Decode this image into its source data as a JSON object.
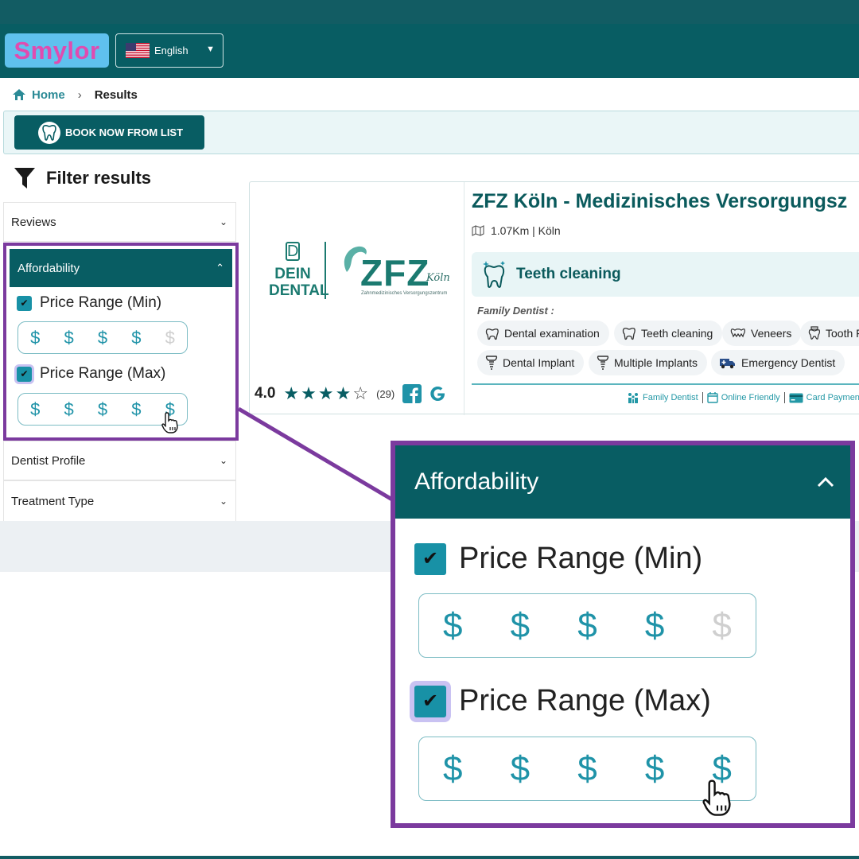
{
  "header": {
    "logo_text": "Smylor",
    "language": "English"
  },
  "breadcrumb": {
    "home": "Home",
    "current": "Results"
  },
  "book_button": "BOOK NOW FROM LIST",
  "filter": {
    "title": "Filter results",
    "sections": {
      "reviews": "Reviews",
      "affordability": "Affordability",
      "dentist_profile": "Dentist Profile",
      "treatment_type": "Treatment Type"
    },
    "price_min": {
      "label": "Price Range (Min)",
      "checked": true,
      "symbols": [
        "$",
        "$",
        "$",
        "$",
        "$"
      ],
      "active_count": 4
    },
    "price_max": {
      "label": "Price Range (Max)",
      "checked": true,
      "symbols": [
        "$",
        "$",
        "$",
        "$",
        "$"
      ],
      "active_count": 5
    }
  },
  "result": {
    "title": "ZFZ Köln - Medizinisches Versorgungsz",
    "distance": "1.07Km | Köln",
    "treatment": "Teeth cleaning",
    "category_label": "Family Dentist :",
    "tags": [
      "Dental examination",
      "Teeth cleaning",
      "Veneers",
      "Tooth F",
      "Dental Implant",
      "Multiple Implants",
      "Emergency Dentist"
    ],
    "rating": "4.0",
    "stars": 4,
    "reviews_count": "(29)",
    "logo": {
      "dein_top": "DEIN",
      "dein_bottom": "DENTAL",
      "brand": "ZFZ",
      "city": "Köln",
      "subtitle": "Zahnmedizinisches Versorgungszentrum"
    },
    "features": [
      "Family Dentist",
      "Online Friendly",
      "Card Paymen"
    ]
  },
  "colors": {
    "header_bg": "#085d63",
    "accent_teal": "#1f93a8",
    "highlight_purple": "#7b3a9e",
    "disabled": "#cfcfcf"
  }
}
